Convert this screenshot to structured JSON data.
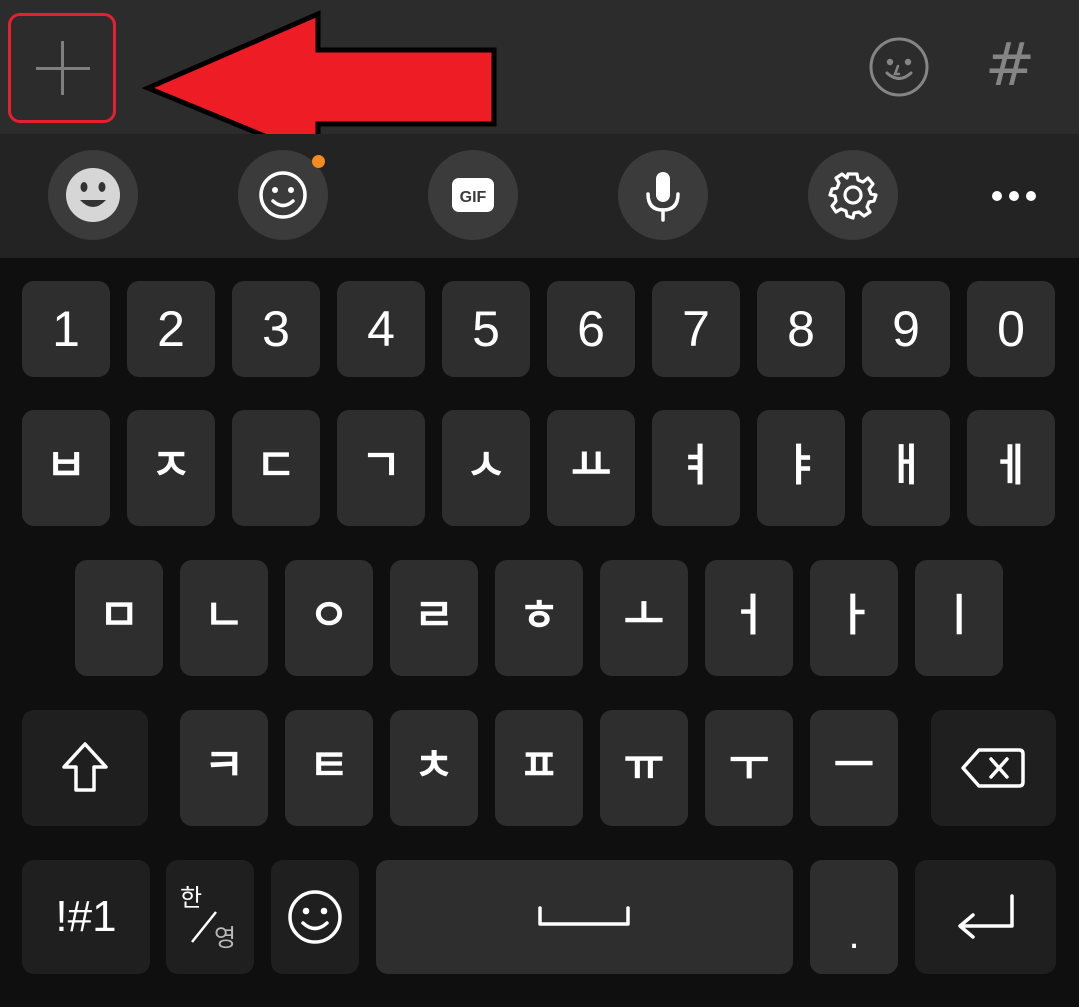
{
  "input_bar": {
    "plus_icon": "plus-icon",
    "emoji_icon": "smiley-face-icon",
    "hashtag_label": "#"
  },
  "annotation": {
    "arrow_color": "#ee1c25",
    "box_color": "#e6202e"
  },
  "toolbar": {
    "items": [
      {
        "name": "bitmoji-button",
        "icon": "bitmoji-face-icon"
      },
      {
        "name": "emoji-button",
        "icon": "smiley-icon",
        "has_notification": true
      },
      {
        "name": "gif-button",
        "icon": "gif-icon",
        "label": "GIF"
      },
      {
        "name": "voice-input-button",
        "icon": "microphone-icon"
      },
      {
        "name": "settings-button",
        "icon": "gear-icon"
      },
      {
        "name": "more-button",
        "icon": "more-dots-icon"
      }
    ]
  },
  "keyboard": {
    "number_row": [
      "1",
      "2",
      "3",
      "4",
      "5",
      "6",
      "7",
      "8",
      "9",
      "0"
    ],
    "row1": [
      "ㅂ",
      "ㅈ",
      "ㄷ",
      "ㄱ",
      "ㅅ",
      "ㅛ",
      "ㅕ",
      "ㅑ",
      "ㅐ",
      "ㅔ"
    ],
    "row2": [
      "ㅁ",
      "ㄴ",
      "ㅇ",
      "ㄹ",
      "ㅎ",
      "ㅗ",
      "ㅓ",
      "ㅏ",
      "ㅣ"
    ],
    "row3": [
      "ㅋ",
      "ㅌ",
      "ㅊ",
      "ㅍ",
      "ㅠ",
      "ㅜ",
      "ㅡ"
    ],
    "bottom": {
      "symbols_label": "!#1",
      "lang_top": "한",
      "lang_bottom": "영",
      "period_label": "."
    },
    "icons": {
      "shift": "shift-arrow-icon",
      "backspace": "backspace-icon",
      "emoji": "smiley-icon",
      "space": "space-bar-icon",
      "enter": "enter-return-icon"
    }
  }
}
